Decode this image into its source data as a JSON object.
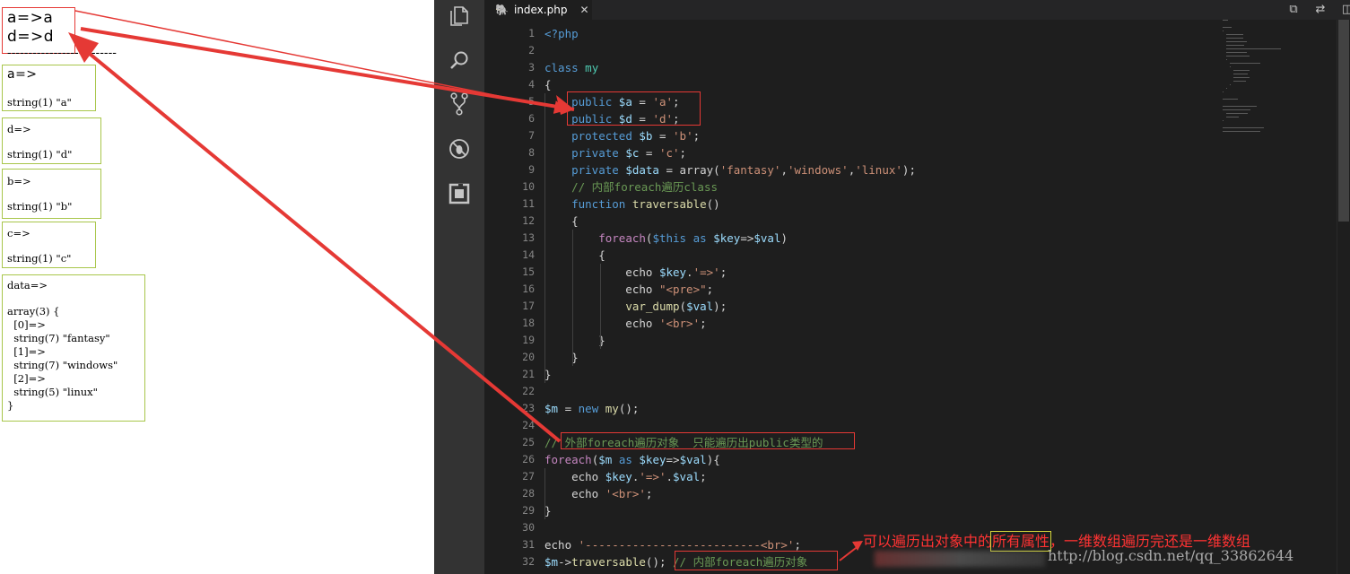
{
  "browser_output": {
    "header_lines": [
      "a=>a",
      "d=>d"
    ],
    "separator": "--------------------------",
    "blocks": [
      {
        "key": "a=>",
        "value": "string(1) \"a\""
      },
      {
        "key": "d=>",
        "value": "string(1) \"d\""
      },
      {
        "key": "b=>",
        "value": "string(1) \"b\""
      },
      {
        "key": "c=>",
        "value": "string(1) \"c\""
      }
    ],
    "data_block": {
      "key": "data=>",
      "lines": [
        "array(3) {",
        "  [0]=>",
        "  string(7) \"fantasy\"",
        "  [1]=>",
        "  string(7) \"windows\"",
        "  [2]=>",
        "  string(5) \"linux\"",
        "}"
      ]
    }
  },
  "editor": {
    "tab": {
      "icon": "php-elephant-icon",
      "filename": "index.php",
      "close": "✕"
    },
    "activity_icons": [
      "explorer-icon",
      "search-icon",
      "source-control-icon",
      "debug-icon",
      "extensions-icon"
    ],
    "line_numbers": [
      "1",
      "2",
      "3",
      "4",
      "5",
      "6",
      "7",
      "8",
      "9",
      "10",
      "11",
      "12",
      "13",
      "14",
      "15",
      "16",
      "17",
      "18",
      "19",
      "20",
      "21",
      "22",
      "23",
      "24",
      "25",
      "26",
      "27",
      "28",
      "29",
      "30",
      "31",
      "32"
    ],
    "code_lines": [
      "<?php",
      "",
      "class my",
      "{",
      "    public $a = 'a';",
      "    public $d = 'd';",
      "    protected $b = 'b';",
      "    private $c = 'c';",
      "    private $data = array('fantasy','windows','linux');",
      "    // 内部foreach遍历class",
      "    function traversable()",
      "    {",
      "        foreach($this as $key=>$val)",
      "        {",
      "            echo $key.'=>';",
      "            echo \"<pre>\";",
      "            var_dump($val);",
      "            echo '<br>';",
      "        }",
      "    }",
      "}",
      "",
      "$m = new my();",
      "",
      "// 外部foreach遍历对象  只能遍历出public类型的",
      "foreach($m as $key=>$val){",
      "    echo $key.'=>'.$val;",
      "    echo '<br>';",
      "}",
      "",
      "echo '--------------------------<br>';",
      "$m->traversable(); // 内部foreach遍历对象"
    ]
  },
  "annotations": {
    "note_parts": [
      "可以遍历出对象中的",
      "所有属性",
      "，一维数组遍历完还是一维数组"
    ],
    "watermark": "http://blog.csdn.net/qq_33862644"
  },
  "colors": {
    "arrow_red": "#e53935",
    "box_green": "#a8c64a",
    "note_red": "#ff3333",
    "highlight_yellow": "#d4d43a",
    "editor_bg": "#1e1e1e",
    "activity_bg": "#333333"
  }
}
